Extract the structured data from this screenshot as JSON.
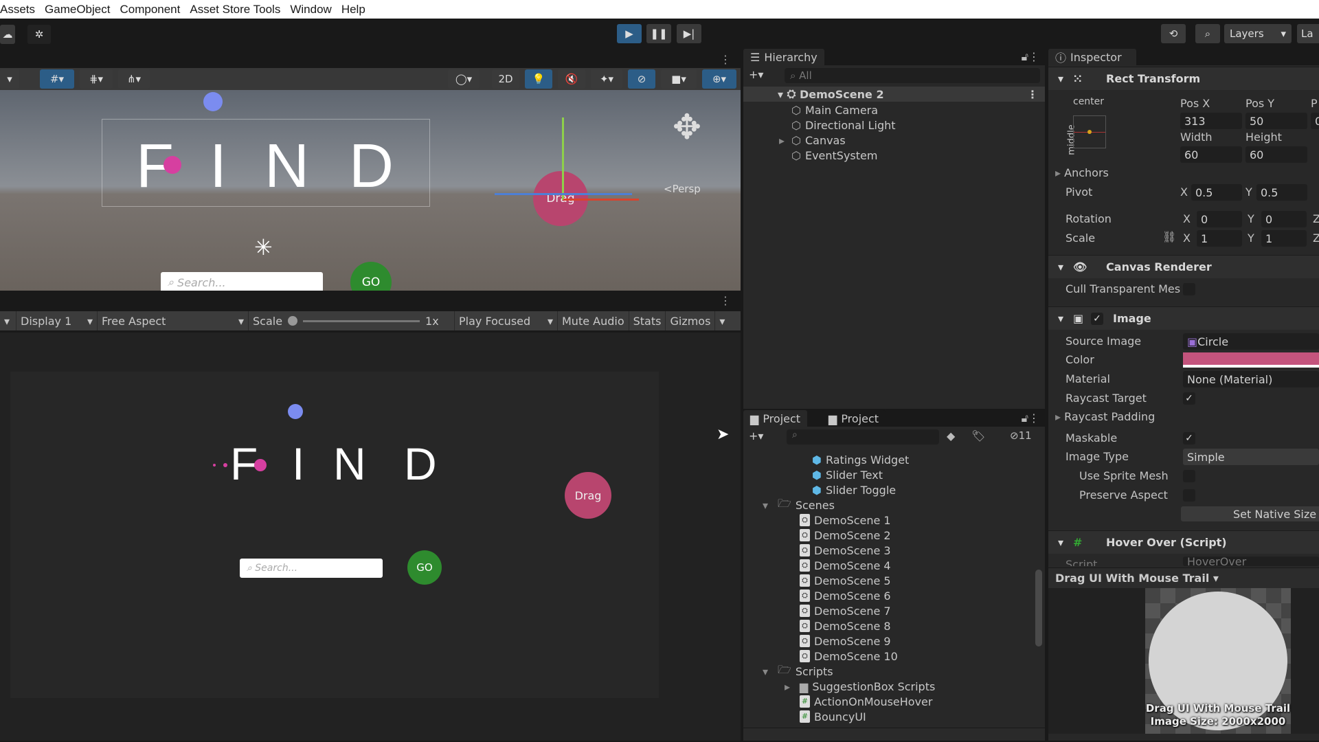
{
  "menu": [
    "Assets",
    "GameObject",
    "Component",
    "Asset Store Tools",
    "Window",
    "Help"
  ],
  "toolbar": {
    "layers_label": "Layers",
    "layout_label": "La"
  },
  "scene": {
    "toggle_2d": "2D",
    "persp_label": "<Persp",
    "find_letters": [
      "F",
      "I",
      "N",
      "D"
    ],
    "drag_label": "Drag",
    "search_placeholder": "Search...",
    "go_label": "GO"
  },
  "game": {
    "display": "Display 1",
    "aspect": "Free Aspect",
    "scale_label": "Scale",
    "scale_value": "1x",
    "play_mode": "Play Focused",
    "mute": "Mute Audio",
    "stats": "Stats",
    "gizmos": "Gizmos",
    "find_letters": [
      "F",
      "I",
      "N",
      "D"
    ],
    "drag_label": "Drag",
    "search_placeholder": "Search...",
    "go_label": "GO",
    "colors": {
      "drag": "#b8456e",
      "go": "#2e8b2e",
      "dot": "#7b8cf0",
      "trail": "#d63fa0"
    }
  },
  "hierarchy": {
    "title": "Hierarchy",
    "search_placeholder": "All",
    "scene": "DemoScene 2",
    "items": [
      {
        "label": "Main Camera",
        "expandable": false
      },
      {
        "label": "Directional Light",
        "expandable": false
      },
      {
        "label": "Canvas",
        "expandable": true
      },
      {
        "label": "EventSystem",
        "expandable": false
      }
    ]
  },
  "project": {
    "tabs": [
      "Project",
      "Project"
    ],
    "hidden_count": "11",
    "items": [
      {
        "label": "Ratings Widget",
        "type": "prefab",
        "level": 3
      },
      {
        "label": "Slider Text",
        "type": "prefab",
        "level": 3
      },
      {
        "label": "Slider Toggle",
        "type": "prefab",
        "level": 3
      },
      {
        "label": "Scenes",
        "type": "folder-open",
        "level": 1
      },
      {
        "label": "DemoScene 1",
        "type": "scene",
        "level": 2
      },
      {
        "label": "DemoScene 2",
        "type": "scene",
        "level": 2
      },
      {
        "label": "DemoScene 3",
        "type": "scene",
        "level": 2
      },
      {
        "label": "DemoScene 4",
        "type": "scene",
        "level": 2
      },
      {
        "label": "DemoScene 5",
        "type": "scene",
        "level": 2
      },
      {
        "label": "DemoScene 6",
        "type": "scene",
        "level": 2
      },
      {
        "label": "DemoScene 7",
        "type": "scene",
        "level": 2
      },
      {
        "label": "DemoScene 8",
        "type": "scene",
        "level": 2
      },
      {
        "label": "DemoScene 9",
        "type": "scene",
        "level": 2
      },
      {
        "label": "DemoScene 10",
        "type": "scene",
        "level": 2
      },
      {
        "label": "Scripts",
        "type": "folder-open",
        "level": 1
      },
      {
        "label": "SuggestionBox Scripts",
        "type": "folder",
        "level": 2
      },
      {
        "label": "ActionOnMouseHover",
        "type": "script",
        "level": 2
      },
      {
        "label": "BouncyUI",
        "type": "script",
        "level": 2
      }
    ]
  },
  "inspector": {
    "title": "Inspector",
    "rect": {
      "title": "Rect Transform",
      "anchor_h": "center",
      "anchor_v": "middle",
      "posx_label": "Pos X",
      "posy_label": "Pos Y",
      "posz_label": "P",
      "posx": "313",
      "posy": "50",
      "posz": "0",
      "width_label": "Width",
      "height_label": "Height",
      "width": "60",
      "height": "60",
      "anchors": "Anchors",
      "pivot": "Pivot",
      "pivot_x": "0.5",
      "pivot_y": "0.5",
      "rotation": "Rotation",
      "rot_x": "0",
      "rot_y": "0",
      "scale": "Scale",
      "scale_x": "1",
      "scale_y": "1",
      "x": "X",
      "y": "Y",
      "z": "Z"
    },
    "canvas_renderer": {
      "title": "Canvas Renderer",
      "cull_label": "Cull Transparent Mes",
      "cull": false
    },
    "image": {
      "title": "Image",
      "enabled": true,
      "source_label": "Source Image",
      "source": "Circle",
      "color_label": "Color",
      "color": "#c4547d",
      "material_label": "Material",
      "material": "None (Material)",
      "raycast_label": "Raycast Target",
      "raycast": true,
      "padding_label": "Raycast Padding",
      "maskable_label": "Maskable",
      "maskable": true,
      "type_label": "Image Type",
      "type": "Simple",
      "sprite_mesh_label": "Use Sprite Mesh",
      "sprite_mesh": false,
      "preserve_label": "Preserve Aspect",
      "preserve": false,
      "native_size": "Set Native Size"
    },
    "hover": {
      "title": "Hover Over (Script)",
      "script_label": "Script",
      "script": "HoverOver"
    },
    "preview": {
      "title": "Drag UI With Mouse Trail",
      "caption": "Drag UI With Mouse Trail",
      "size": "Image Size: 2000x2000"
    }
  }
}
